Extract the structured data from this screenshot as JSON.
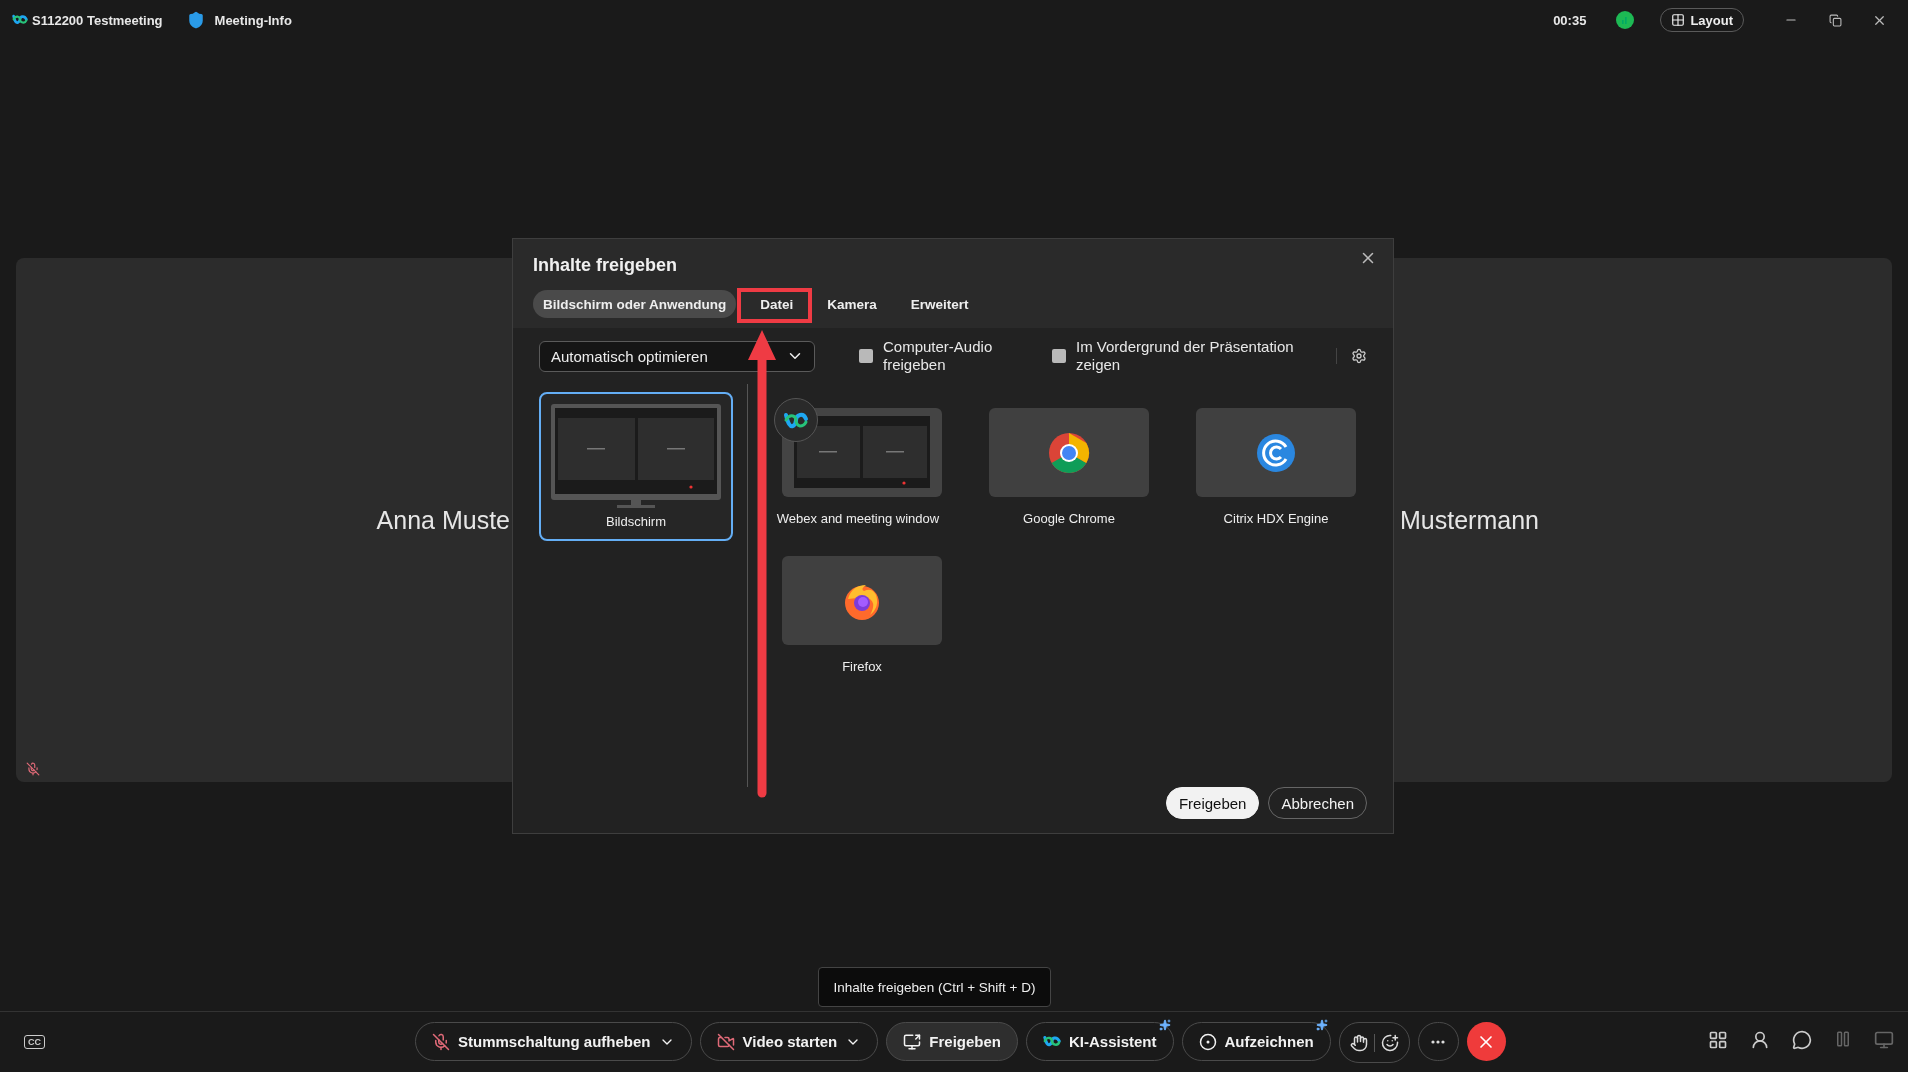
{
  "title_bar": {
    "meeting_name": "S112200 Testmeeting",
    "meeting_info": "Meeting-Info",
    "timer": "00:35",
    "layout_button": "Layout"
  },
  "participants": [
    {
      "name": "Anna Muste",
      "muted": true
    },
    {
      "name": "Mustermann",
      "muted": false
    }
  ],
  "dialog": {
    "title": "Inhalte freigeben",
    "tabs": [
      {
        "label": "Bildschirm oder Anwendung",
        "selected": true
      },
      {
        "label": "Datei",
        "selected": false
      },
      {
        "label": "Kamera",
        "selected": false
      },
      {
        "label": "Erweitert",
        "selected": false
      }
    ],
    "optimize_dropdown": "Automatisch optimieren",
    "options": [
      {
        "label": "Computer-Audio freigeben",
        "checked": false
      },
      {
        "label": "Im Vordergrund der Präsentation zeigen",
        "checked": false
      }
    ],
    "screens": [
      {
        "label": "Bildschirm",
        "selected": true
      }
    ],
    "apps": [
      {
        "label": "Webex and meeting window",
        "kind": "webex",
        "selected": false
      },
      {
        "label": "Google Chrome",
        "kind": "chrome",
        "selected": false
      },
      {
        "label": "Citrix HDX Engine",
        "kind": "citrix",
        "selected": false
      },
      {
        "label": "Firefox",
        "kind": "firefox",
        "selected": false
      }
    ],
    "buttons": [
      {
        "label": "Freigeben",
        "kind": "primary"
      },
      {
        "label": "Abbrechen",
        "kind": "secondary"
      }
    ]
  },
  "tooltip": "Inhalte freigeben (Ctrl + Shift + D)",
  "captions": "CC",
  "controls": [
    {
      "label": "Stummschaltung aufheben",
      "kind": "mic-off",
      "dropdown": true,
      "sparkle": false
    },
    {
      "label": "Video starten",
      "kind": "video-off",
      "dropdown": true,
      "sparkle": false
    },
    {
      "label": "Freigeben",
      "kind": "share",
      "dropdown": false,
      "sparkle": false
    },
    {
      "label": "KI-Assistent",
      "kind": "ai",
      "dropdown": false,
      "sparkle": true
    },
    {
      "label": "Aufzeichnen",
      "kind": "record",
      "dropdown": false,
      "sparkle": true
    }
  ]
}
